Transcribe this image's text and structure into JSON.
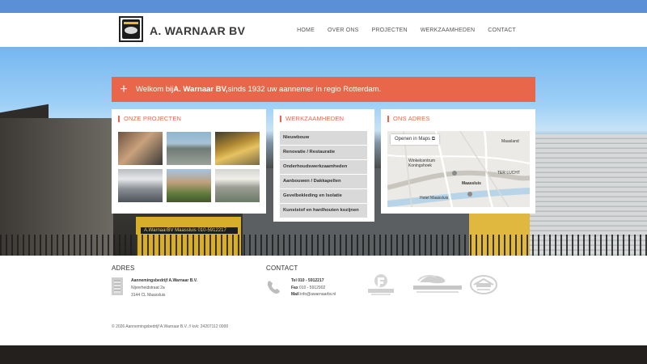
{
  "header": {
    "brand": "A. WARNAAR BV",
    "nav": [
      "HOME",
      "OVER ONS",
      "PROJECTEN",
      "WERKZAAMHEDEN",
      "CONTACT"
    ]
  },
  "hero": {
    "sign_text": "A.WarnaarBV  Maassluis  010-5912217"
  },
  "banner": {
    "prefix": "Welkom bij ",
    "company": "A. Warnaar BV,",
    "suffix": " sinds 1932 uw aannemer in regio Rotterdam."
  },
  "projects": {
    "title": "ONZE PROJECTEN"
  },
  "werkzaamheden": {
    "title": "WERKZAAMHEDEN",
    "items": [
      "Nieuwbouw",
      "Renovatie / Restauratie",
      "Onderhoudswerkzaamheden",
      "Aanbouwen / Dakkapellen",
      "Gevelbekleding en Isolatie",
      "Kunststof en hardhouten kozijnen"
    ]
  },
  "adres": {
    "title": "ONS ADRES",
    "map_button": "Openen in Maps",
    "map_labels": [
      "Maasland",
      "Winkelcentrum Koningshoek",
      "TER LUCHT",
      "Maassluis",
      "Hotel Maassluis"
    ]
  },
  "footer": {
    "adres_heading": "ADRES",
    "company": "Aannemingsbedrijf A.Warnaar B.V.",
    "street": "Nijverheidstraat 2a",
    "city": "3144 CL Maassluis",
    "contact_heading": "CONTACT",
    "tel_label": "Tel",
    "tel_value": "010 - 5912217",
    "fax_label": "Fax",
    "fax_value": "010 - 5912902",
    "mail_label": "Mail",
    "mail_value": "info@awarnaarbv.nl",
    "copyright": "© 2026 Aannemingsbedrijf A.Warnaar B.V.  //  kvk: 24207112 0000"
  },
  "colors": {
    "accent": "#e8674a",
    "header_top": "#5b8fd6"
  }
}
